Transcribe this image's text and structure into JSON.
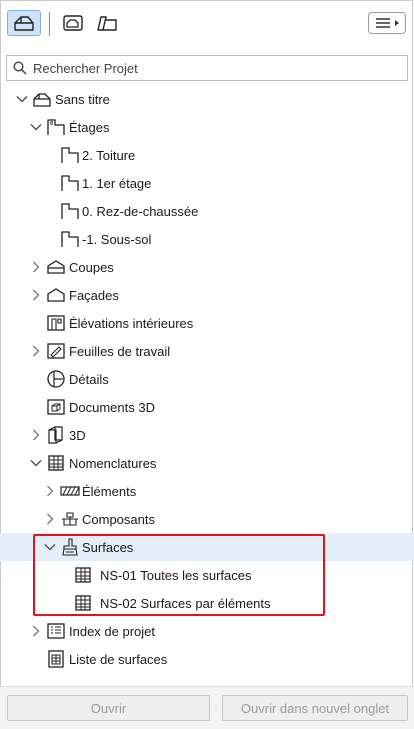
{
  "toolbar": {
    "tabs": [
      {
        "icon": "project-map-icon",
        "active": true
      },
      {
        "icon": "view-map-icon",
        "active": false
      },
      {
        "icon": "layout-book-icon",
        "active": false
      }
    ],
    "menu_icon": "hamburger-menu-icon"
  },
  "search": {
    "placeholder": "Rechercher Projet",
    "value": ""
  },
  "tree": {
    "root": "Sans titre",
    "etages": "Étages",
    "etage_1": "2. Toiture",
    "etage_2": "1. 1er étage",
    "etage_3": "0. Rez-de-chaussée",
    "etage_4": "-1. Sous-sol",
    "coupes": "Coupes",
    "facades": "Façades",
    "elevations": "Élévations intérieures",
    "feuilles": "Feuilles de travail",
    "details": "Détails",
    "documents3d": "Documents 3D",
    "vue3d": "3D",
    "nomenclatures": "Nomenclatures",
    "elements": "Éléments",
    "composants": "Composants",
    "surfaces": "Surfaces",
    "ns01": "NS-01 Toutes les surfaces",
    "ns02": "NS-02 Surfaces par éléments",
    "index": "Index de projet",
    "liste": "Liste de surfaces"
  },
  "footer": {
    "open": "Ouvrir",
    "open_new_tab": "Ouvrir dans nouvel onglet"
  },
  "colors": {
    "selected_row": "#e4eef9",
    "highlight_border": "#e0141e",
    "active_tab": "#cfe3f7"
  }
}
